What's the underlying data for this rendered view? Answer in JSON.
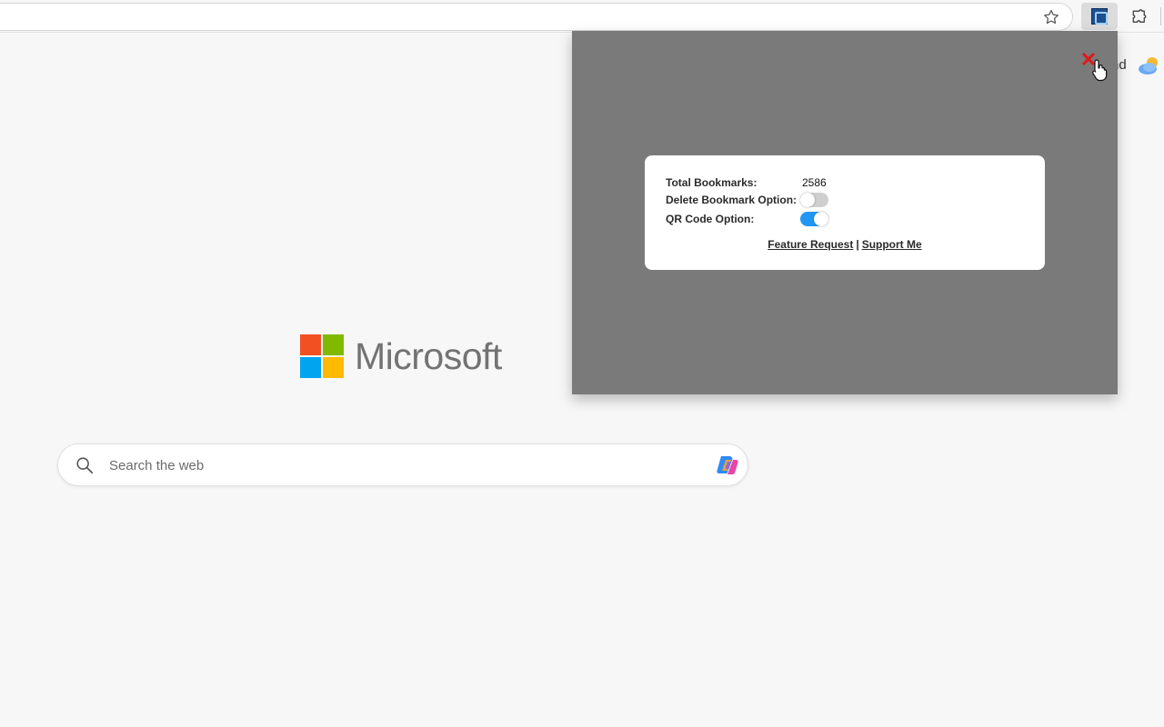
{
  "toolbar": {
    "bookmark_star_icon": "star-outline",
    "extension_icon": "bookmark-extension",
    "extensions_icon": "puzzle"
  },
  "weather": {
    "text": "nd",
    "icon": "partly-cloudy"
  },
  "brand": {
    "wordmark": "Microsoft",
    "logo_colors": [
      "#f25022",
      "#7fba00",
      "#00a4ef",
      "#ffb900"
    ]
  },
  "search": {
    "placeholder": "Search the web",
    "value": ""
  },
  "popup": {
    "close_symbol": "✕",
    "close_color": "#e01818",
    "total_bookmarks_label": "Total Bookmarks:",
    "total_bookmarks_value": "2586",
    "delete_option_label": "Delete Bookmark Option:",
    "delete_option_enabled": false,
    "qr_option_label": "QR Code Option:",
    "qr_option_enabled": true,
    "feature_request_link": "Feature Request",
    "separator": "|",
    "support_link": "Support Me",
    "toggle_on_color": "#2196f3"
  }
}
